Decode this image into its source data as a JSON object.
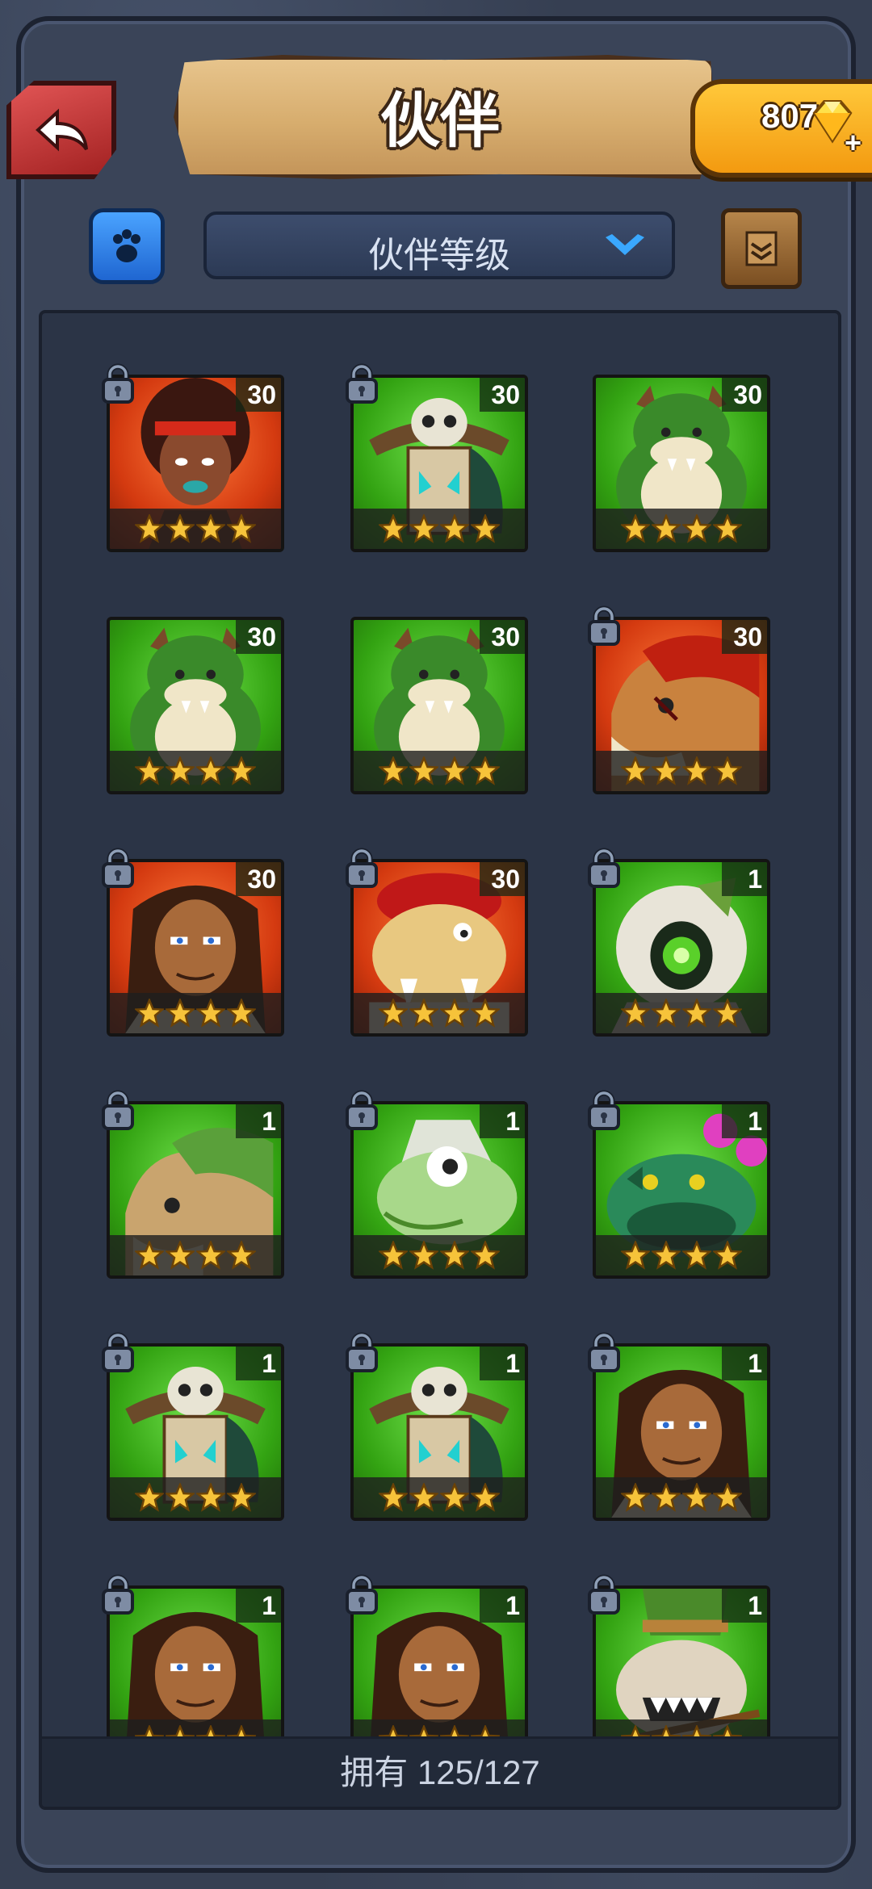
{
  "header": {
    "title": "伙伴",
    "gems": "807",
    "gem_plus": "+"
  },
  "toolbar": {
    "sort_label": "伙伴等级"
  },
  "owned": "拥有 125/127",
  "colors": {
    "accent_green": "#33a312",
    "accent_red": "#d43a10",
    "gold": "#f3b21c"
  },
  "partners": [
    {
      "level": "30",
      "bg": "red",
      "portrait": "afro-woman",
      "locked": true,
      "stars": 4
    },
    {
      "level": "30",
      "bg": "green",
      "portrait": "skull-totem",
      "locked": true,
      "stars": 4
    },
    {
      "level": "30",
      "bg": "green",
      "portrait": "green-bear",
      "locked": false,
      "stars": 4
    },
    {
      "level": "30",
      "bg": "green",
      "portrait": "green-bear",
      "locked": false,
      "stars": 4
    },
    {
      "level": "30",
      "bg": "green",
      "portrait": "green-bear",
      "locked": false,
      "stars": 4
    },
    {
      "level": "30",
      "bg": "red",
      "portrait": "red-wolf",
      "locked": true,
      "stars": 4
    },
    {
      "level": "30",
      "bg": "red",
      "portrait": "barbarian",
      "locked": true,
      "stars": 4
    },
    {
      "level": "30",
      "bg": "red",
      "portrait": "red-ogre",
      "locked": true,
      "stars": 4
    },
    {
      "level": "1",
      "bg": "green",
      "portrait": "hooded-eye",
      "locked": true,
      "stars": 4
    },
    {
      "level": "1",
      "bg": "green",
      "portrait": "green-wolf",
      "locked": true,
      "stars": 4
    },
    {
      "level": "1",
      "bg": "green",
      "portrait": "chameleon",
      "locked": true,
      "stars": 4
    },
    {
      "level": "1",
      "bg": "green",
      "portrait": "frog-flower",
      "locked": true,
      "stars": 4
    },
    {
      "level": "1",
      "bg": "green",
      "portrait": "skull-totem",
      "locked": true,
      "stars": 4
    },
    {
      "level": "1",
      "bg": "green",
      "portrait": "skull-totem",
      "locked": true,
      "stars": 4
    },
    {
      "level": "1",
      "bg": "green",
      "portrait": "barbarian",
      "locked": true,
      "stars": 4
    },
    {
      "level": "1",
      "bg": "green",
      "portrait": "barbarian",
      "locked": true,
      "stars": 4
    },
    {
      "level": "1",
      "bg": "green",
      "portrait": "barbarian",
      "locked": true,
      "stars": 4
    },
    {
      "level": "1",
      "bg": "green",
      "portrait": "goblin-witch",
      "locked": true,
      "stars": 4
    }
  ]
}
